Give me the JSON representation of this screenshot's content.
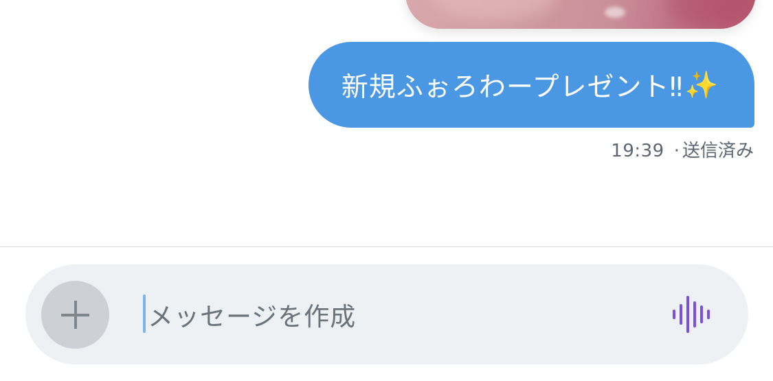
{
  "message": {
    "text": "新規ふぉろわープレゼント‼︎",
    "emoji": "✨",
    "time": "19:39",
    "separator": "·",
    "status": "送信済み"
  },
  "composer": {
    "placeholder": "メッセージを作成",
    "add_icon": "plus-icon",
    "voice_icon": "voice-waveform-icon"
  },
  "colors": {
    "bubble": "#4a97e3",
    "composer_bg": "#eef1f3",
    "voice_accent": "#7b4fe0"
  }
}
